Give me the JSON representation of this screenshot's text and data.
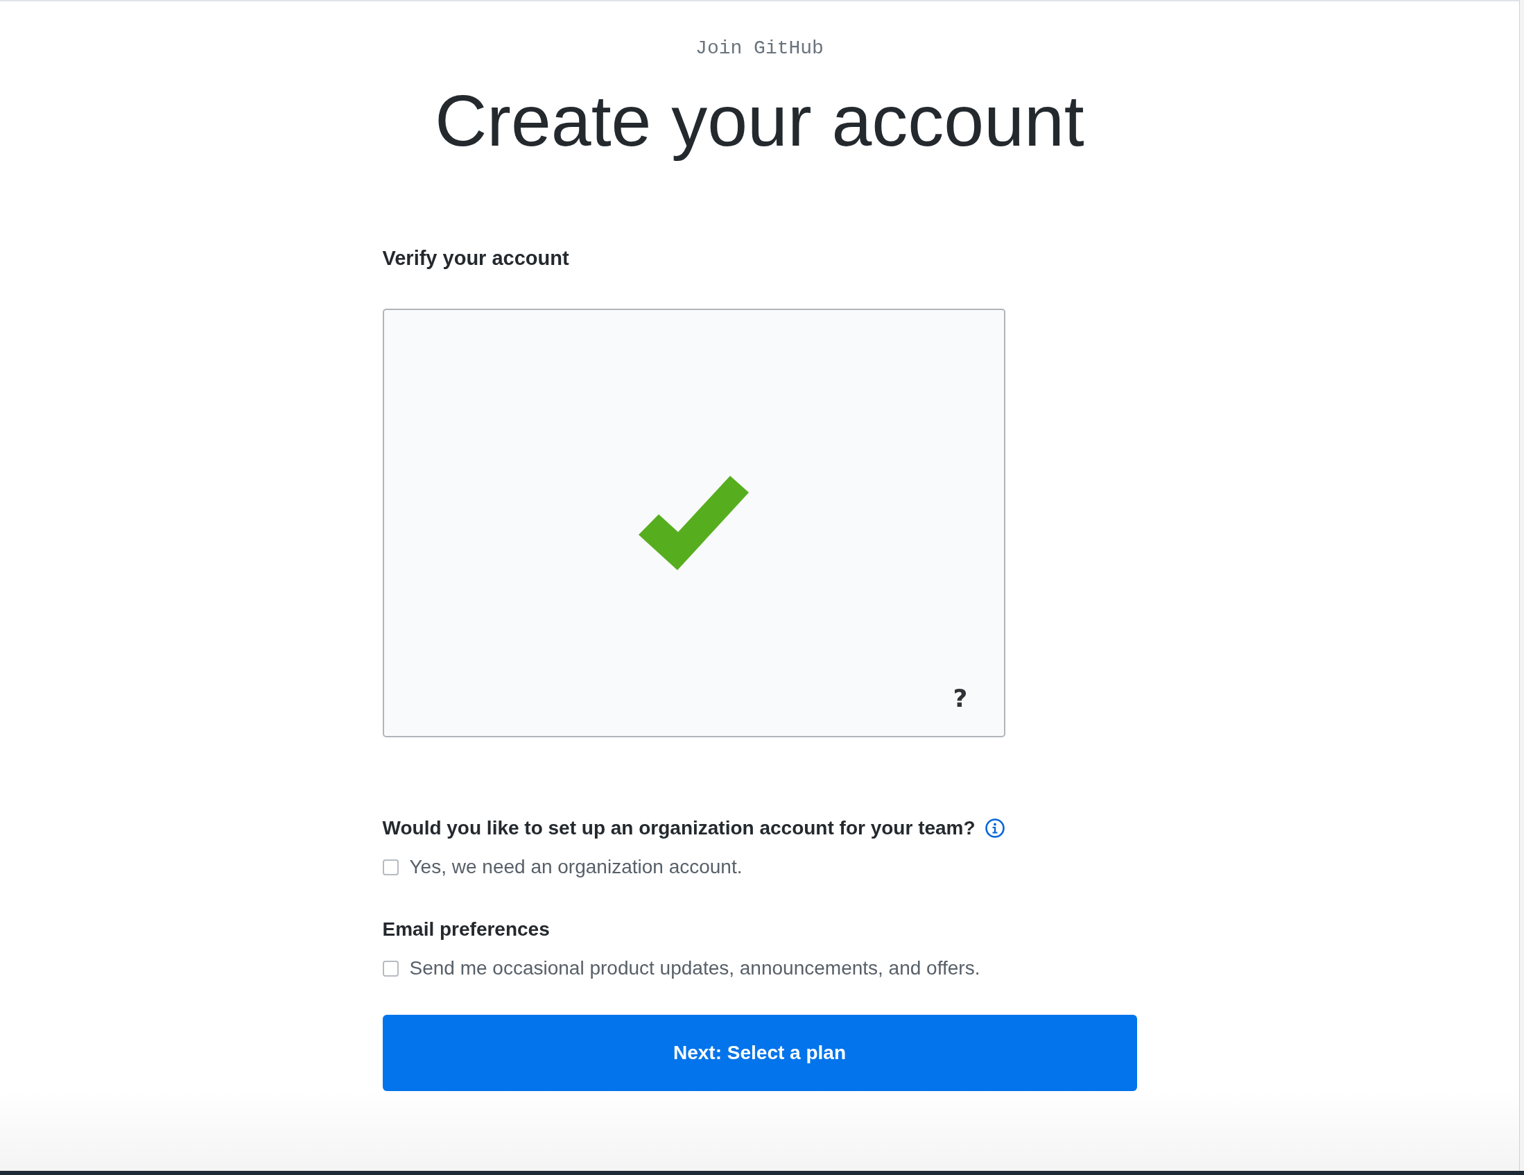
{
  "header": {
    "eyebrow": "Join GitHub",
    "title": "Create your account"
  },
  "verification": {
    "heading": "Verify your account",
    "verified": true,
    "help": "?"
  },
  "organization": {
    "question": "Would you like to set up an organization account for your team?",
    "option": {
      "label": "Yes, we need an organization account.",
      "checked": false
    }
  },
  "email_preferences": {
    "heading": "Email preferences",
    "option": {
      "label": "Send me occasional product updates, announcements, and offers.",
      "checked": false
    }
  },
  "submit": {
    "label": "Next: Select a plan"
  }
}
